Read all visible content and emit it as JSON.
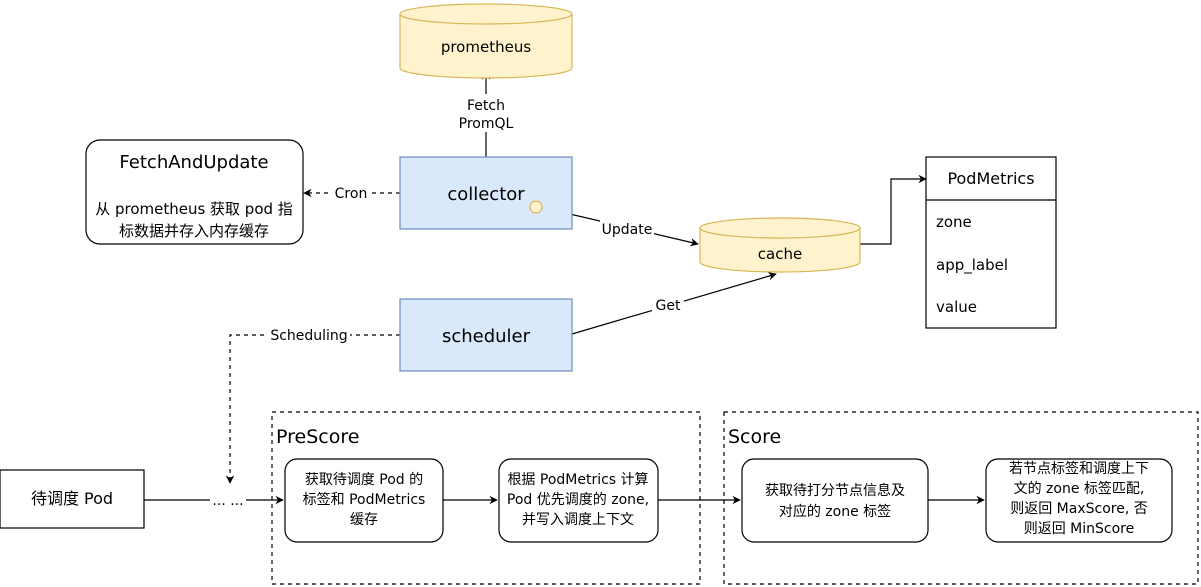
{
  "nodes": {
    "prometheus": "prometheus",
    "collector": "collector",
    "scheduler": "scheduler",
    "cache": "cache",
    "fetch_update": {
      "title": "FetchAndUpdate",
      "line1": "从 prometheus 获取 pod 指",
      "line2": "标数据并存入内存缓存"
    },
    "podmetrics": {
      "title": "PodMetrics",
      "fields": [
        "zone",
        "app_label",
        "value"
      ]
    },
    "pending_pod": "待调度 Pod",
    "ellipsis": "... ...",
    "prescore": {
      "title": "PreScore",
      "step1": [
        "获取待调度 Pod 的",
        "标签和 PodMetrics",
        "缓存"
      ],
      "step2": [
        "根据 PodMetrics 计算",
        "Pod 优先调度的 zone,",
        "并写入调度上下文"
      ]
    },
    "score": {
      "title": "Score",
      "step1": [
        "获取待打分节点信息及",
        "对应的 zone 标签"
      ],
      "step2": [
        "若节点标签和调度上下",
        "文的 zone 标签匹配,",
        "则返回 MaxScore, 否",
        "则返回 MinScore"
      ]
    }
  },
  "edges": {
    "fetch_promql": [
      "Fetch",
      "PromQL"
    ],
    "cron": "Cron",
    "update": "Update",
    "get": "Get",
    "scheduling": "Scheduling"
  }
}
